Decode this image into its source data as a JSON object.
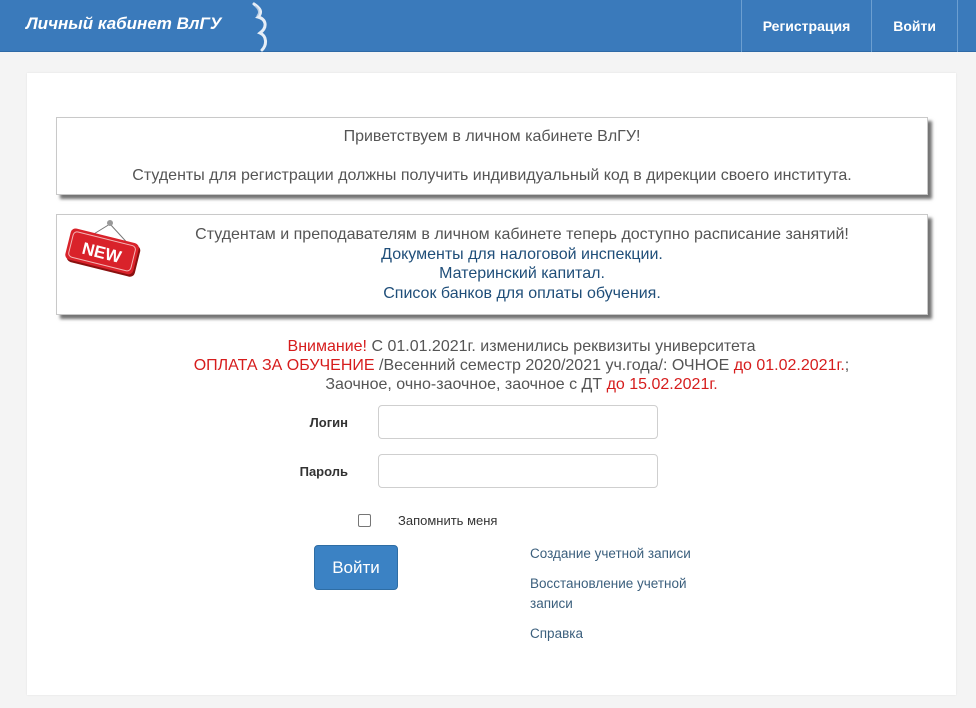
{
  "header": {
    "brand": "Личный кабинет ВлГУ",
    "nav": [
      {
        "label": "Регистрация"
      },
      {
        "label": "Войти"
      }
    ]
  },
  "notice1": {
    "line1": "Приветствуем в личном кабинете ВлГУ!",
    "line2": "Студенты для регистрации должны получить индивидуальный код в дирекции своего института."
  },
  "notice2": {
    "badge": "NEW",
    "main": "Студентам и преподавателям в личном кабинете теперь доступно расписание занятий!",
    "links": [
      "Документы для налоговой инспекции.",
      "Материнский капитал.",
      "Список банков для оплаты обучения."
    ]
  },
  "warning": {
    "attention": "Внимание!",
    "line1_rest": " С 01.01.2021г. изменились реквизиты университета",
    "pay": "ОПЛАТА ЗА ОБУЧЕНИЕ",
    "line2_mid": " /Весенний семестр 2020/2021 уч.года/: ОЧНОЕ ",
    "date1": "до 01.02.2021г.",
    "line2_end": ";",
    "line3_start": "Заочное, очно-заочное, заочное с ДТ ",
    "date2": "до 15.02.2021г."
  },
  "form": {
    "login_label": "Логин",
    "login_value": "",
    "password_label": "Пароль",
    "password_value": "",
    "remember_label": "Запомнить меня",
    "remember_checked": false,
    "submit_label": "Войти"
  },
  "links": {
    "create": "Создание учетной записи",
    "restore": "Восстановление учетной записи",
    "help": "Справка"
  },
  "colors": {
    "navbar": "#3a7abb",
    "accent_red": "#d61d1d",
    "button": "#3b82c4",
    "link": "#1f4e79"
  }
}
